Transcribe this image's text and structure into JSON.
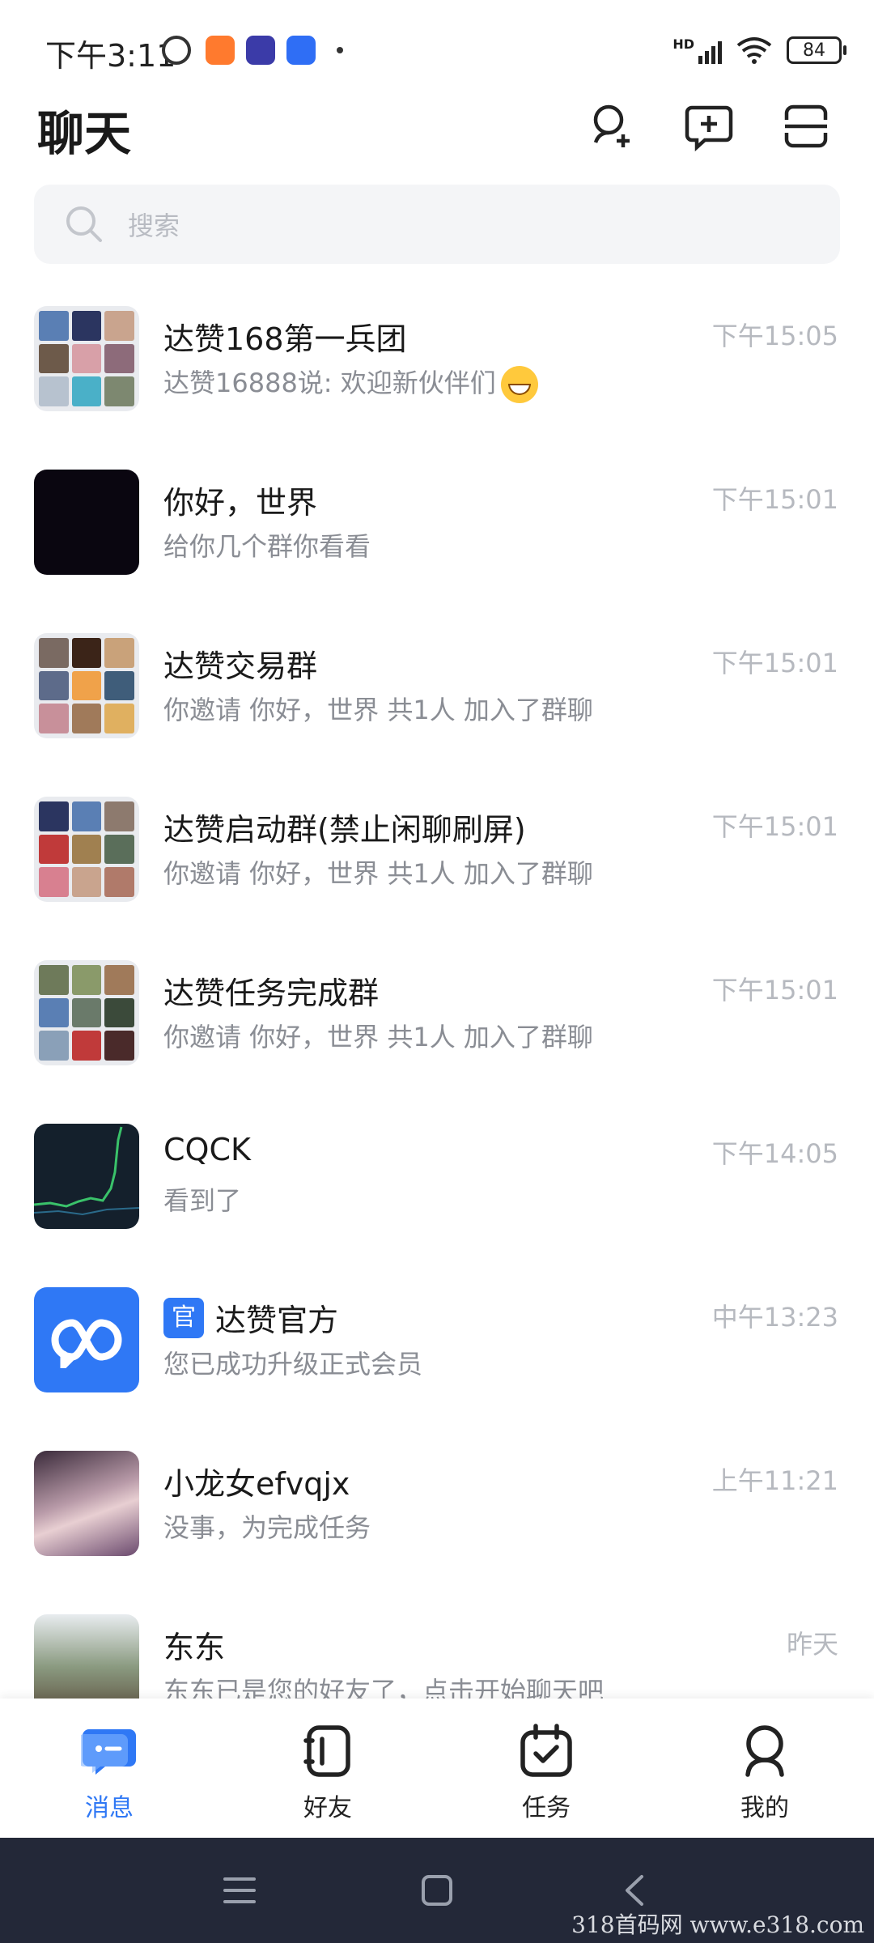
{
  "status_bar": {
    "time": "下午3:11",
    "signal_label": "HD",
    "battery": "84"
  },
  "header": {
    "title": "聊天"
  },
  "search": {
    "placeholder": "搜索"
  },
  "chats": [
    {
      "name": "达赞168第一兵团",
      "preview": "达赞16888说: 欢迎新伙伴们",
      "time": "下午15:05",
      "avatar_type": "grid",
      "has_emoji": true
    },
    {
      "name": "你好，世界",
      "preview": "给你几个群你看看",
      "time": "下午15:01",
      "avatar_type": "solid",
      "avatar_color": "#0a0610"
    },
    {
      "name": "达赞交易群",
      "preview": "你邀请  你好，世界  共1人 加入了群聊",
      "time": "下午15:01",
      "avatar_type": "grid"
    },
    {
      "name": "达赞启动群(禁止闲聊刷屏)",
      "preview": "你邀请  你好，世界  共1人 加入了群聊",
      "time": "下午15:01",
      "avatar_type": "grid"
    },
    {
      "name": "达赞任务完成群",
      "preview": "你邀请  你好，世界  共1人 加入了群聊",
      "time": "下午15:01",
      "avatar_type": "grid"
    },
    {
      "name": "CQCK",
      "preview": "看到了",
      "time": "下午14:05",
      "avatar_type": "chart",
      "avatar_color": "#14202c"
    },
    {
      "name": "达赞官方",
      "preview": "您已成功升级正式会员",
      "time": "中午13:23",
      "avatar_type": "brand",
      "avatar_color": "#2f78f5",
      "badge": "官"
    },
    {
      "name": "小龙女efvqjx",
      "preview": "没事，为完成任务",
      "time": "上午11:21",
      "avatar_type": "photo",
      "avatar_color": "#6b4a6e"
    },
    {
      "name": "东东",
      "preview": "东东已是您的好友了，点击开始聊天吧",
      "time": "昨天",
      "avatar_type": "photo",
      "avatar_color": "#7a8a70"
    }
  ],
  "bottom_nav": [
    {
      "label": "消息",
      "icon": "message-icon",
      "active": true
    },
    {
      "label": "好友",
      "icon": "contacts-icon",
      "active": false
    },
    {
      "label": "任务",
      "icon": "task-icon",
      "active": false
    },
    {
      "label": "我的",
      "icon": "profile-icon",
      "active": false
    }
  ],
  "colors": {
    "accent": "#2f78f5",
    "time_text": "#b6b9bf",
    "preview_text": "#8a8d94",
    "system_nav": "#232838"
  },
  "watermark": "318首码网  www.e318.com"
}
